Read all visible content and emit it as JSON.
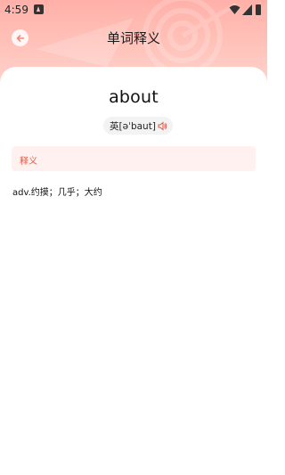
{
  "status_bar": {
    "time": "4:59"
  },
  "nav": {
    "title": "单词释义"
  },
  "word": {
    "text": "about"
  },
  "pronunciation": {
    "label": "英[əˈbaut]"
  },
  "definitions": {
    "section_title": "释义",
    "items": [
      "adv.约摸；几乎；大约"
    ]
  },
  "icons": {
    "back": "back-arrow-icon",
    "speaker": "speaker-icon",
    "wifi": "wifi-icon",
    "signal": "signal-icon",
    "battery": "battery-icon",
    "notification": "notification-icon"
  },
  "colors": {
    "header_gradient_top": "#ffb0a8",
    "header_gradient_bottom": "#ffd9d2",
    "accent": "#e15a45",
    "section_bg": "#fff1ef"
  }
}
